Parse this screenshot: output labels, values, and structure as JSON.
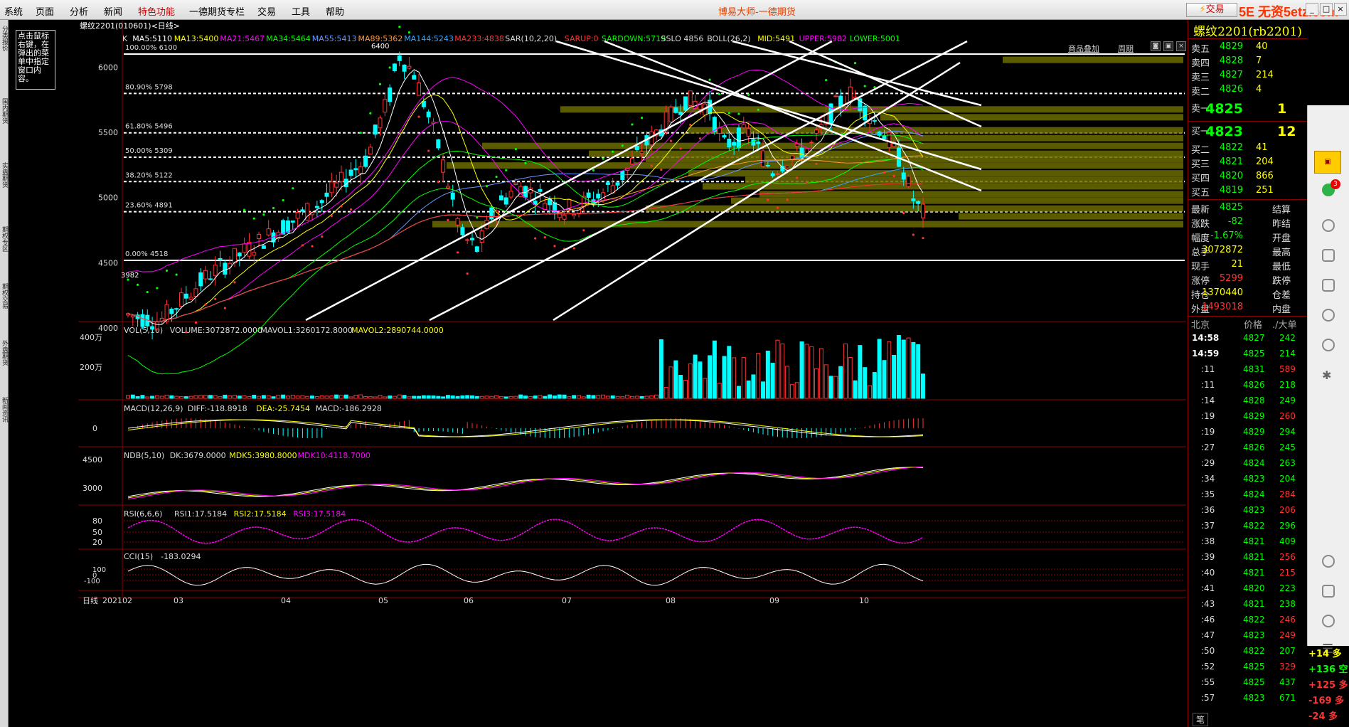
{
  "menu": [
    "系统",
    "页面",
    "分析",
    "新闻",
    "特色功能",
    "一德期货专栏",
    "交易",
    "工具",
    "帮助"
  ],
  "app_title": "博易大师-一德期货",
  "trade_button": "交易",
  "watermark": "5E 无资5etz.com",
  "hint": "点击鼠标右键，在弹出的菜单中指定窗口内容。",
  "left_tabs": [
    "分类报价",
    "国内期货",
    "实盘期货",
    "期权专区",
    "期权交易",
    "外盘期货",
    "新闻资讯"
  ],
  "chart": {
    "title": "螺纹2201(010601)<日线>",
    "tools": [
      "商品叠加",
      "周期"
    ],
    "main_legend": [
      {
        "text": "K",
        "color": "#dddddd"
      },
      {
        "text": "MA5:5110",
        "color": "#ffffff"
      },
      {
        "text": "MA13:5400",
        "color": "#ffff00"
      },
      {
        "text": "MA21:5467",
        "color": "#ff00ff"
      },
      {
        "text": "MA34:5464",
        "color": "#00ff00"
      },
      {
        "text": "MA55:5413",
        "color": "#6699ff"
      },
      {
        "text": "MA89:5362",
        "color": "#ff9933"
      },
      {
        "text": "MA144:5243",
        "color": "#33aaff"
      },
      {
        "text": "MA233:4838",
        "color": "#ff3333"
      },
      {
        "text": "SAR(10,2,20)",
        "color": "#dddddd"
      },
      {
        "text": "SARUP:0",
        "color": "#ff3333"
      },
      {
        "text": "SARDOWN:5719",
        "color": "#00ff00"
      },
      {
        "text": "SSLO 4856",
        "color": "#dddddd"
      },
      {
        "text": "BOLL(26,2)",
        "color": "#dddddd"
      },
      {
        "text": "MID:5491",
        "color": "#ffff00"
      },
      {
        "text": "UPPER:5982",
        "color": "#ff00ff"
      },
      {
        "text": "LOWER:5001",
        "color": "#00ff00"
      }
    ],
    "price_axis": [
      "6000",
      "5500",
      "5000",
      "4500",
      "4000"
    ],
    "fib_levels": [
      {
        "label": "100.00% 6100",
        "price": 6100
      },
      {
        "label": "80.90% 5798",
        "price": 5798
      },
      {
        "label": "61.80% 5496",
        "price": 5496
      },
      {
        "label": "50.00% 5309",
        "price": 5309
      },
      {
        "label": "38.20% 5122",
        "price": 5122
      },
      {
        "label": "23.60% 4891",
        "price": 4891
      },
      {
        "label": "0.00% 4518",
        "price": 4518
      }
    ],
    "high_mark": "6400",
    "low_mark": "3982",
    "vol_legend": [
      {
        "text": "VOL(5,10)",
        "color": "#dddddd"
      },
      {
        "text": "VOLUME:3072872.0000",
        "color": "#dddddd"
      },
      {
        "text": "MAVOL1:3260172.8000",
        "color": "#dddddd"
      },
      {
        "text": "MAVOL2:2890744.0000",
        "color": "#ffff00"
      }
    ],
    "vol_axis": [
      "400万",
      "200万"
    ],
    "macd_legend": [
      {
        "text": "MACD(12,26,9)",
        "color": "#dddddd"
      },
      {
        "text": "DIFF:-118.8918",
        "color": "#dddddd"
      },
      {
        "text": "DEA:-25.7454",
        "color": "#ffff00"
      },
      {
        "text": "MACD:-186.2928",
        "color": "#dddddd"
      }
    ],
    "macd_axis": [
      "0"
    ],
    "ndb_legend": [
      {
        "text": "NDB(5,10)",
        "color": "#dddddd"
      },
      {
        "text": "DK:3679.0000",
        "color": "#dddddd"
      },
      {
        "text": "MDK5:3980.8000",
        "color": "#ffff00"
      },
      {
        "text": "MDK10:4118.7000",
        "color": "#ff00ff"
      }
    ],
    "ndb_axis": [
      "4500",
      "3000"
    ],
    "rsi_legend": [
      {
        "text": "RSI(6,6,6)",
        "color": "#dddddd"
      },
      {
        "text": "RSI1:17.5184",
        "color": "#dddddd"
      },
      {
        "text": "RSI2:17.5184",
        "color": "#ffff00"
      },
      {
        "text": "RSI3:17.5184",
        "color": "#ff00ff"
      }
    ],
    "rsi_axis": [
      "80",
      "50",
      "20"
    ],
    "cci_legend": [
      {
        "text": "CCI(15)",
        "color": "#dddddd"
      },
      {
        "text": "-183.0294",
        "color": "#dddddd"
      }
    ],
    "cci_axis": [
      "100",
      "0",
      "-100"
    ],
    "period_label": "日线",
    "date_axis": [
      "202102",
      "03",
      "04",
      "05",
      "06",
      "07",
      "08",
      "09",
      "10"
    ]
  },
  "quote": {
    "title": "螺纹2201(rb2201)",
    "asks": [
      {
        "label": "卖五",
        "price": "4829",
        "vol": "40"
      },
      {
        "label": "卖四",
        "price": "4828",
        "vol": "7"
      },
      {
        "label": "卖三",
        "price": "4827",
        "vol": "214"
      },
      {
        "label": "卖二",
        "price": "4826",
        "vol": "4"
      },
      {
        "label": "卖一",
        "price": "4825",
        "vol": "1"
      }
    ],
    "bids": [
      {
        "label": "买一",
        "price": "4823",
        "vol": "12"
      },
      {
        "label": "买二",
        "price": "4822",
        "vol": "41"
      },
      {
        "label": "买三",
        "price": "4821",
        "vol": "204"
      },
      {
        "label": "买四",
        "price": "4820",
        "vol": "866"
      },
      {
        "label": "买五",
        "price": "4819",
        "vol": "251"
      }
    ],
    "stats": [
      {
        "l1": "最新",
        "v1": "4825",
        "c1": "#00ff00",
        "l2": "结算",
        "v2": ""
      },
      {
        "l1": "涨跌",
        "v1": "-82",
        "c1": "#00ff00",
        "l2": "昨结",
        "v2": ""
      },
      {
        "l1": "幅度",
        "v1": "-1.67%",
        "c1": "#00ff00",
        "l2": "开盘",
        "v2": ""
      },
      {
        "l1": "总手",
        "v1": "3072872",
        "c1": "#ffff00",
        "l2": "最高",
        "v2": ""
      },
      {
        "l1": "现手",
        "v1": "21",
        "c1": "#ffff00",
        "l2": "最低",
        "v2": ""
      },
      {
        "l1": "涨停",
        "v1": "5299",
        "c1": "#ff3333",
        "l2": "跌停",
        "v2": ""
      },
      {
        "l1": "持仓",
        "v1": "1370440",
        "c1": "#ffff00",
        "l2": "仓差",
        "v2": ""
      },
      {
        "l1": "外盘",
        "v1": "1493018",
        "c1": "#ff3333",
        "l2": "内盘",
        "v2": ""
      }
    ],
    "tick_header": [
      "北京",
      "价格",
      "./大单"
    ],
    "ticks": [
      {
        "t": "14:58",
        "p": "4827",
        "v": "242",
        "c": "#00ff00"
      },
      {
        "t": "14:59",
        "p": "4825",
        "v": "214",
        "c": "#00ff00"
      },
      {
        "t": ":11",
        "p": "4831",
        "v": "589",
        "c": "#ff3333"
      },
      {
        "t": ":11",
        "p": "4826",
        "v": "218",
        "c": "#00ff00"
      },
      {
        "t": ":14",
        "p": "4828",
        "v": "249",
        "c": "#00ff00"
      },
      {
        "t": ":19",
        "p": "4829",
        "v": "260",
        "c": "#ff3333"
      },
      {
        "t": ":19",
        "p": "4829",
        "v": "294",
        "c": "#00ff00"
      },
      {
        "t": ":27",
        "p": "4826",
        "v": "245",
        "c": "#00ff00"
      },
      {
        "t": ":29",
        "p": "4824",
        "v": "263",
        "c": "#00ff00"
      },
      {
        "t": ":34",
        "p": "4823",
        "v": "204",
        "c": "#00ff00"
      },
      {
        "t": ":35",
        "p": "4824",
        "v": "284",
        "c": "#ff3333"
      },
      {
        "t": ":36",
        "p": "4823",
        "v": "206",
        "c": "#ff3333"
      },
      {
        "t": ":37",
        "p": "4822",
        "v": "296",
        "c": "#00ff00"
      },
      {
        "t": ":38",
        "p": "4821",
        "v": "409",
        "c": "#00ff00"
      },
      {
        "t": ":39",
        "p": "4821",
        "v": "256",
        "c": "#ff3333"
      },
      {
        "t": ":40",
        "p": "4821",
        "v": "215",
        "c": "#ff3333"
      },
      {
        "t": ":41",
        "p": "4820",
        "v": "223",
        "c": "#00ff00"
      },
      {
        "t": ":43",
        "p": "4821",
        "v": "238",
        "c": "#00ff00"
      },
      {
        "t": ":46",
        "p": "4822",
        "v": "246",
        "c": "#ff3333"
      },
      {
        "t": ":47",
        "p": "4823",
        "v": "249",
        "c": "#ff3333"
      },
      {
        "t": ":50",
        "p": "4822",
        "v": "207",
        "c": "#00ff00"
      },
      {
        "t": ":52",
        "p": "4825",
        "v": "329",
        "c": "#ff3333"
      },
      {
        "t": ":55",
        "p": "4825",
        "v": "437",
        "c": "#00ff00"
      },
      {
        "t": ":57",
        "p": "4823",
        "v": "671",
        "c": "#00ff00"
      }
    ],
    "extra_ticks": [
      {
        "text": "+14 多",
        "c": "#ffff00"
      },
      {
        "text": "+136 空",
        "c": "#00ff00"
      },
      {
        "text": "+125 多",
        "c": "#ff3333"
      },
      {
        "text": "-169 多",
        "c": "#ff3333"
      },
      {
        "text": "-24 多",
        "c": "#ff3333"
      }
    ],
    "bottom_tab": "笔"
  },
  "right_badge": "3"
}
